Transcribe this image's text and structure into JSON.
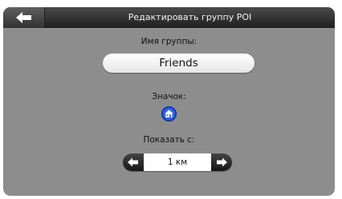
{
  "header": {
    "title": "Редактировать группу POI",
    "back_icon": "arrow-left-icon"
  },
  "form": {
    "group_name_label": "Имя группы:",
    "group_name_value": "Friends",
    "icon_label": "Значок:",
    "icon_name": "building-poi-icon",
    "show_from_label": "Показать с:",
    "show_from_value": "1 км",
    "decrease_icon": "arrow-left-icon",
    "increase_icon": "arrow-right-icon"
  },
  "colors": {
    "background": "#8d8d8d",
    "titlebar": "#2b2b2b",
    "poi_icon_blue": "#1f4fd6"
  }
}
